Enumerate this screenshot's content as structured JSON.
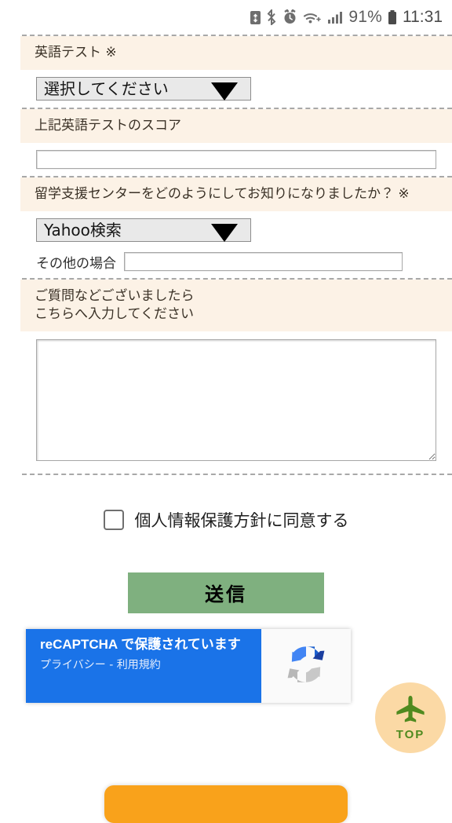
{
  "statusbar": {
    "icons": [
      "battery-saver-icon",
      "bluetooth-icon",
      "alarm-icon",
      "wifi-icon",
      "signal-icon"
    ],
    "battery_percent": "91%",
    "time": "11:31"
  },
  "form": {
    "sections": [
      {
        "label": "英語テスト ※",
        "control": "select",
        "value": "選択してください"
      },
      {
        "label": "上記英語テストのスコア",
        "control": "text",
        "value": "",
        "placeholder": ""
      },
      {
        "label": "留学支援センターをどのようにしてお知りになりましたか？ ※",
        "control": "select-with-other",
        "value": "Yahoo検索",
        "other_label": "その他の場合",
        "other_value": "",
        "other_placeholder": ""
      },
      {
        "label": "ご質問などございましたら\nこちらへ入力してください",
        "control": "textarea",
        "value": "",
        "placeholder": ""
      }
    ],
    "consent": {
      "label": "個人情報保護方針に同意する",
      "checked": false
    },
    "submit_label": "送信"
  },
  "recaptcha": {
    "title": "reCAPTCHA で保護されています",
    "privacy": "プライバシー",
    "separator": "-",
    "terms": "利用規約",
    "logo": "recaptcha-logo-icon"
  },
  "top_button": {
    "label": "TOP",
    "icon": "airplane-icon"
  },
  "colors": {
    "label_band": "#fcf2e6",
    "submit_green": "#7fb07f",
    "recaptcha_blue": "#1a73e8",
    "top_button_bg": "#fbd9a5",
    "top_button_fg": "#4f8a1f",
    "bottom_bar_orange": "#f9a21b"
  }
}
